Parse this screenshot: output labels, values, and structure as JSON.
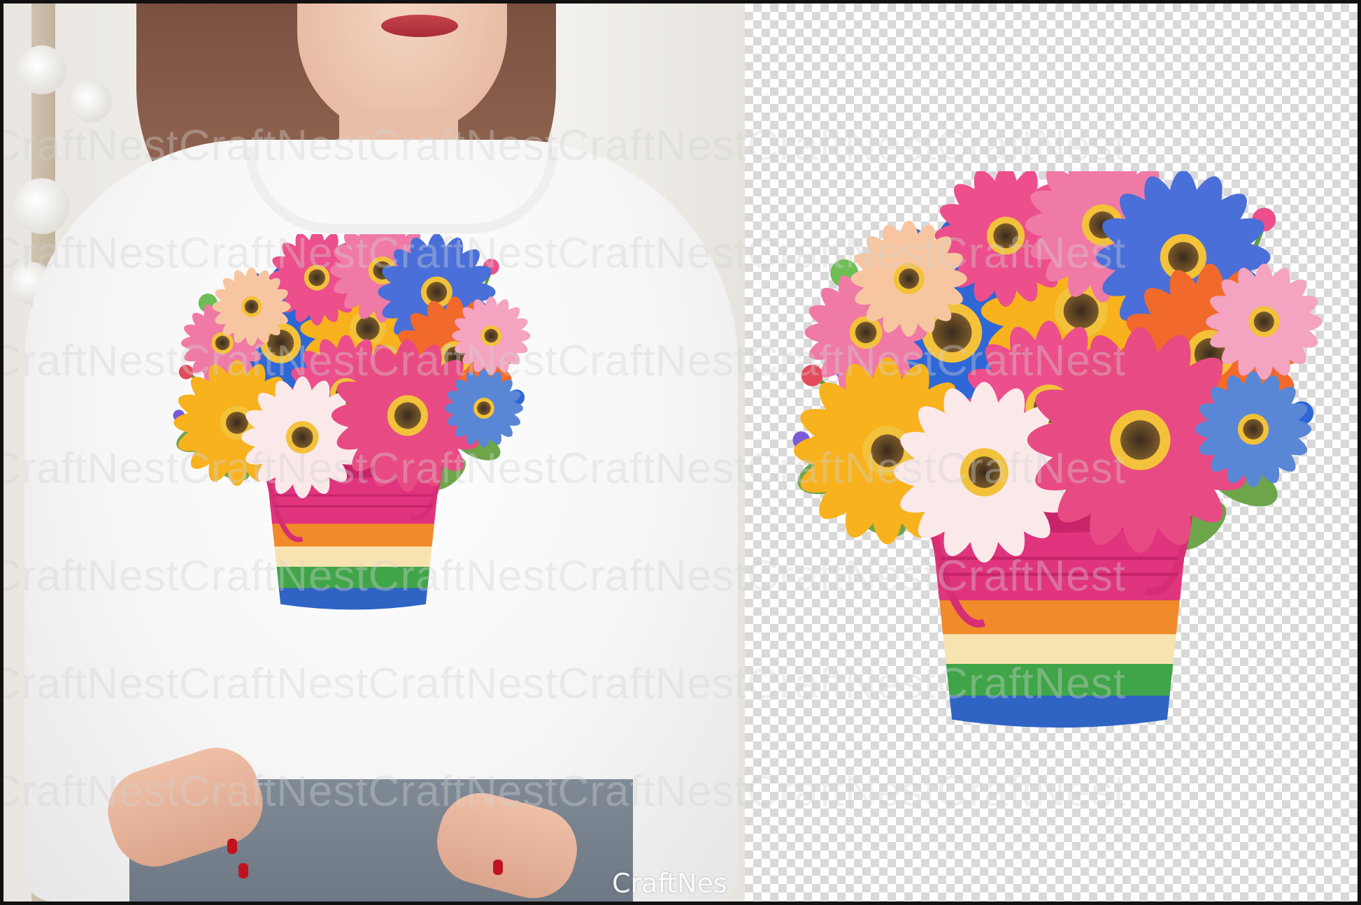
{
  "watermark": {
    "text": "CraftNestCraftNestCraftNestCraftNestCraftNestCraftNest"
  },
  "brand": {
    "label": "CraftNes"
  },
  "colors": {
    "frame": "#111111",
    "bucket_pink": "#e0357e",
    "stripe_orange": "#f08a2a",
    "stripe_cream": "#f7e3b0",
    "stripe_green": "#3fa548",
    "stripe_blue": "#2f63c4",
    "flower_blue": "#2f67d6",
    "flower_yellow": "#f7b21d",
    "flower_pink": "#ec4f8c",
    "flower_orange": "#f26a2b",
    "flower_purple": "#8b4fd8",
    "flower_white": "#fbe9ea",
    "leaf_green": "#6da54a"
  }
}
